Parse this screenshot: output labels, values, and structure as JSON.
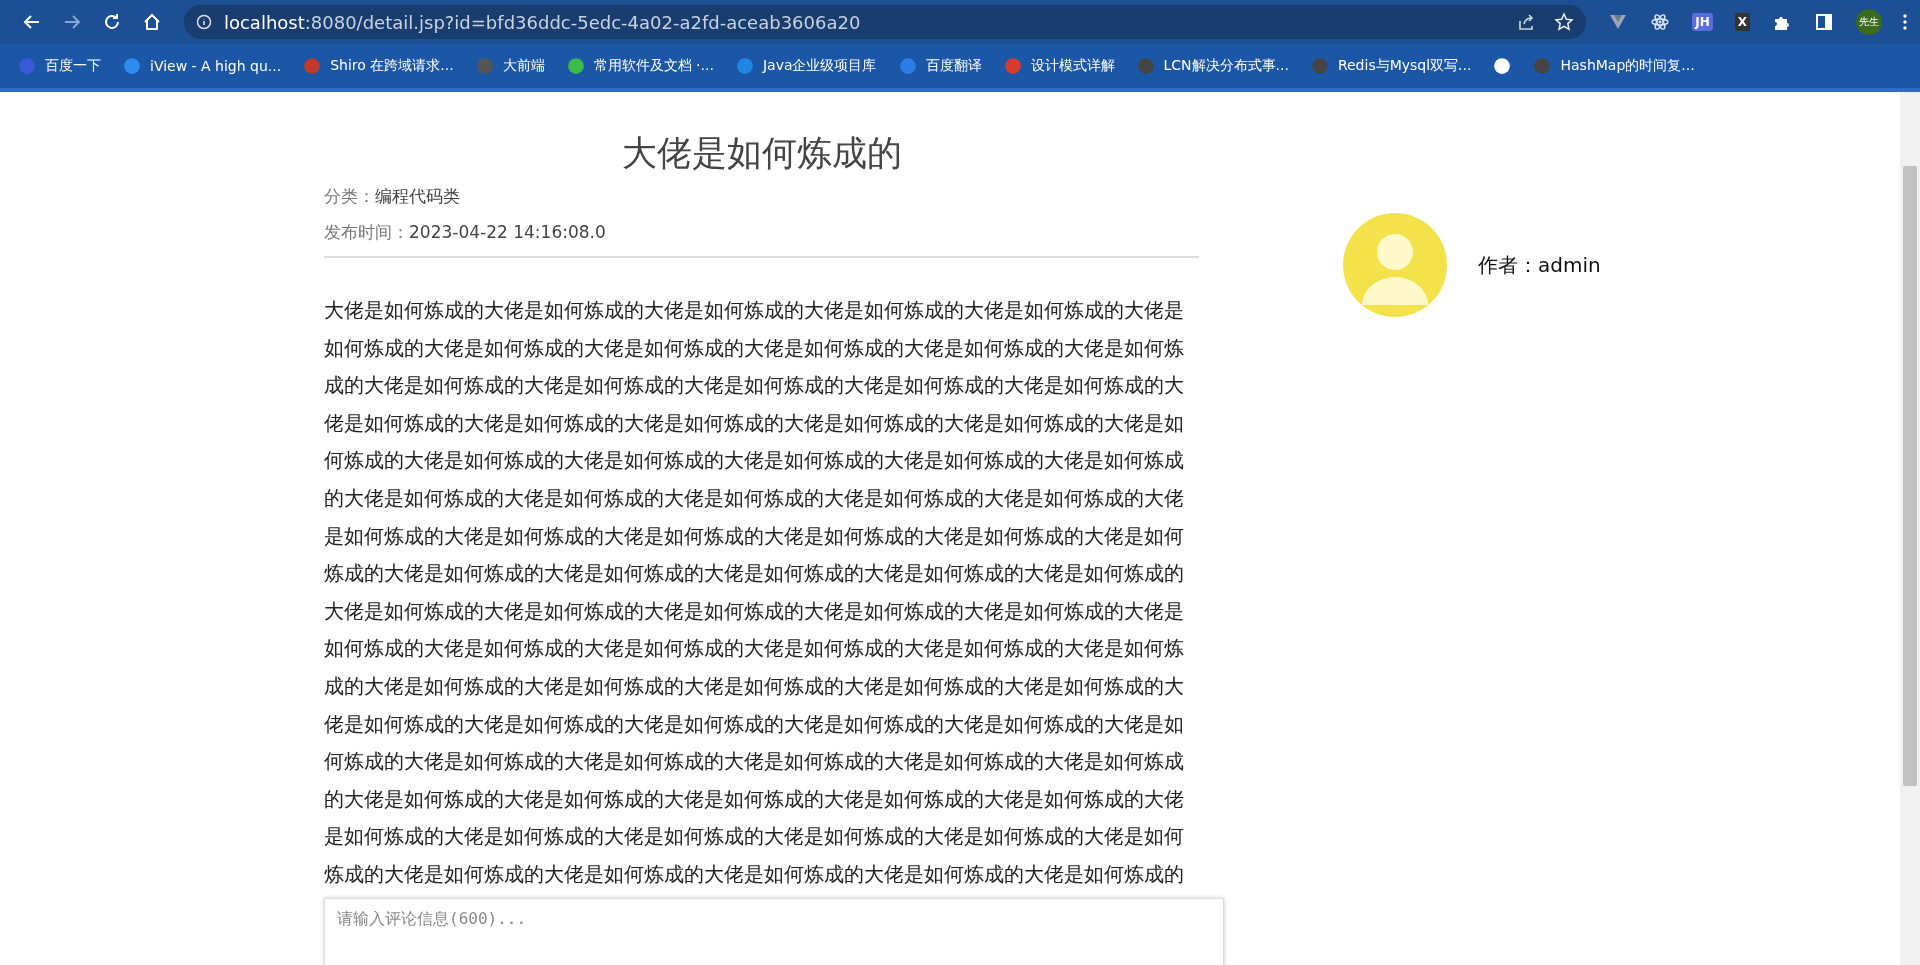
{
  "browser": {
    "url_host": "localhost",
    "url_rest": ":8080/detail.jsp?id=bfd36ddc-5edc-4a02-a2fd-aceab3606a20",
    "extensions": [
      {
        "kind": "v"
      },
      {
        "kind": "atom"
      },
      {
        "kind": "text",
        "label": "JH"
      },
      {
        "kind": "text",
        "label": "X"
      },
      {
        "kind": "puzzle"
      },
      {
        "kind": "sidebar"
      }
    ],
    "profile": "先生",
    "bookmarks": [
      {
        "label": "百度一下",
        "color": "#3a5bd9"
      },
      {
        "label": "iView - A high qu...",
        "color": "#2d8cf0"
      },
      {
        "label": "Shiro 在跨域请求...",
        "color": "#c0392b"
      },
      {
        "label": "大前端",
        "color": "#555555"
      },
      {
        "label": "常用软件及文档 ·...",
        "color": "#3dbb4a"
      },
      {
        "label": "Java企业级项目库",
        "color": "#1e88e5"
      },
      {
        "label": "百度翻译",
        "color": "#2b7de9"
      },
      {
        "label": "设计模式详解",
        "color": "#d83a2e"
      },
      {
        "label": "LCN解决分布式事...",
        "color": "#444444"
      },
      {
        "label": "Redis与Mysql双写...",
        "color": "#444444"
      },
      {
        "color": "#ffffff"
      },
      {
        "label": "HashMap的时间复...",
        "color": "#444444"
      }
    ]
  },
  "article": {
    "title": "大佬是如何炼成的",
    "category_label": "分类：",
    "category": "编程代码类",
    "time_label": "发布时间：",
    "time": "2023-04-22 14:16:08.0",
    "body": "大佬是如何炼成的大佬是如何炼成的大佬是如何炼成的大佬是如何炼成的大佬是如何炼成的大佬是如何炼成的大佬是如何炼成的大佬是如何炼成的大佬是如何炼成的大佬是如何炼成的大佬是如何炼成的大佬是如何炼成的大佬是如何炼成的大佬是如何炼成的大佬是如何炼成的大佬是如何炼成的大佬是如何炼成的大佬是如何炼成的大佬是如何炼成的大佬是如何炼成的大佬是如何炼成的大佬是如何炼成的大佬是如何炼成的大佬是如何炼成的大佬是如何炼成的大佬是如何炼成的大佬是如何炼成的大佬是如何炼成的大佬是如何炼成的大佬是如何炼成的大佬是如何炼成的大佬是如何炼成的大佬是如何炼成的大佬是如何炼成的大佬是如何炼成的大佬是如何炼成的大佬是如何炼成的大佬是如何炼成的大佬是如何炼成的大佬是如何炼成的大佬是如何炼成的大佬是如何炼成的大佬是如何炼成的大佬是如何炼成的大佬是如何炼成的大佬是如何炼成的大佬是如何炼成的大佬是如何炼成的大佬是如何炼成的大佬是如何炼成的大佬是如何炼成的大佬是如何炼成的大佬是如何炼成的大佬是如何炼成的大佬是如何炼成的大佬是如何炼成的大佬是如何炼成的大佬是如何炼成的大佬是如何炼成的大佬是如何炼成的大佬是如何炼成的大佬是如何炼成的大佬是如何炼成的大佬是如何炼成的大佬是如何炼成的大佬是如何炼成的大佬是如何炼成的大佬是如何炼成的大佬是如何炼成的大佬是如何炼成的大佬是如何炼成的大佬是如何炼成的大佬是如何炼成的大佬是如何炼成的大佬是如何炼成的大佬是如何炼成的大佬是如何炼成的大佬是如何炼成的大佬是如何炼成的大佬是如何炼成的大佬是如何炼成的大佬是如何炼成的大佬是如何炼成的大佬是如何炼成的大佬是如何炼成的大佬是如何炼成的",
    "comment_placeholder": "请输入评论信息(600)..."
  },
  "author": {
    "label": "作者：",
    "name": "admin"
  }
}
